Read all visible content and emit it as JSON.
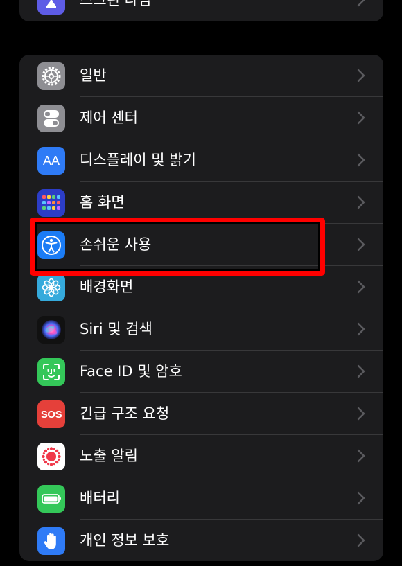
{
  "top_group": {
    "item": {
      "label": "스크린 타임",
      "icon": "hourglass-icon",
      "color": "#5e5ce6"
    }
  },
  "settings": {
    "items": [
      {
        "key": "general",
        "label": "일반",
        "icon": "gear-icon",
        "color": "#8e8e93"
      },
      {
        "key": "control-center",
        "label": "제어 센터",
        "icon": "toggles-icon",
        "color": "#8e8e93"
      },
      {
        "key": "display",
        "label": "디스플레이 및 밝기",
        "icon": "text-size-icon",
        "color": "#2f7bf6"
      },
      {
        "key": "home-screen",
        "label": "홈 화면",
        "icon": "app-grid-icon",
        "color": "#2c3dc7"
      },
      {
        "key": "accessibility",
        "label": "손쉬운 사용",
        "icon": "accessibility-icon",
        "color": "#1b7cf5"
      },
      {
        "key": "wallpaper",
        "label": "배경화면",
        "icon": "flower-icon",
        "color": "#35aadc"
      },
      {
        "key": "siri",
        "label": "Siri 및 검색",
        "icon": "siri-icon",
        "color": "#111111"
      },
      {
        "key": "face-id",
        "label": "Face ID 및 암호",
        "icon": "face-id-icon",
        "color": "#34c759"
      },
      {
        "key": "sos",
        "label": "긴급 구조 요청",
        "icon": "sos-icon",
        "color": "#e5403a"
      },
      {
        "key": "exposure",
        "label": "노출 알림",
        "icon": "exposure-icon",
        "color": "#ffffff"
      },
      {
        "key": "battery",
        "label": "배터리",
        "icon": "battery-icon",
        "color": "#34c759"
      },
      {
        "key": "privacy",
        "label": "개인 정보 보호",
        "icon": "hand-icon",
        "color": "#2f7bf6"
      }
    ],
    "sos_text": "SOS",
    "display_text": "AA"
  },
  "highlight": {
    "target": "accessibility",
    "color": "#ff0000"
  }
}
